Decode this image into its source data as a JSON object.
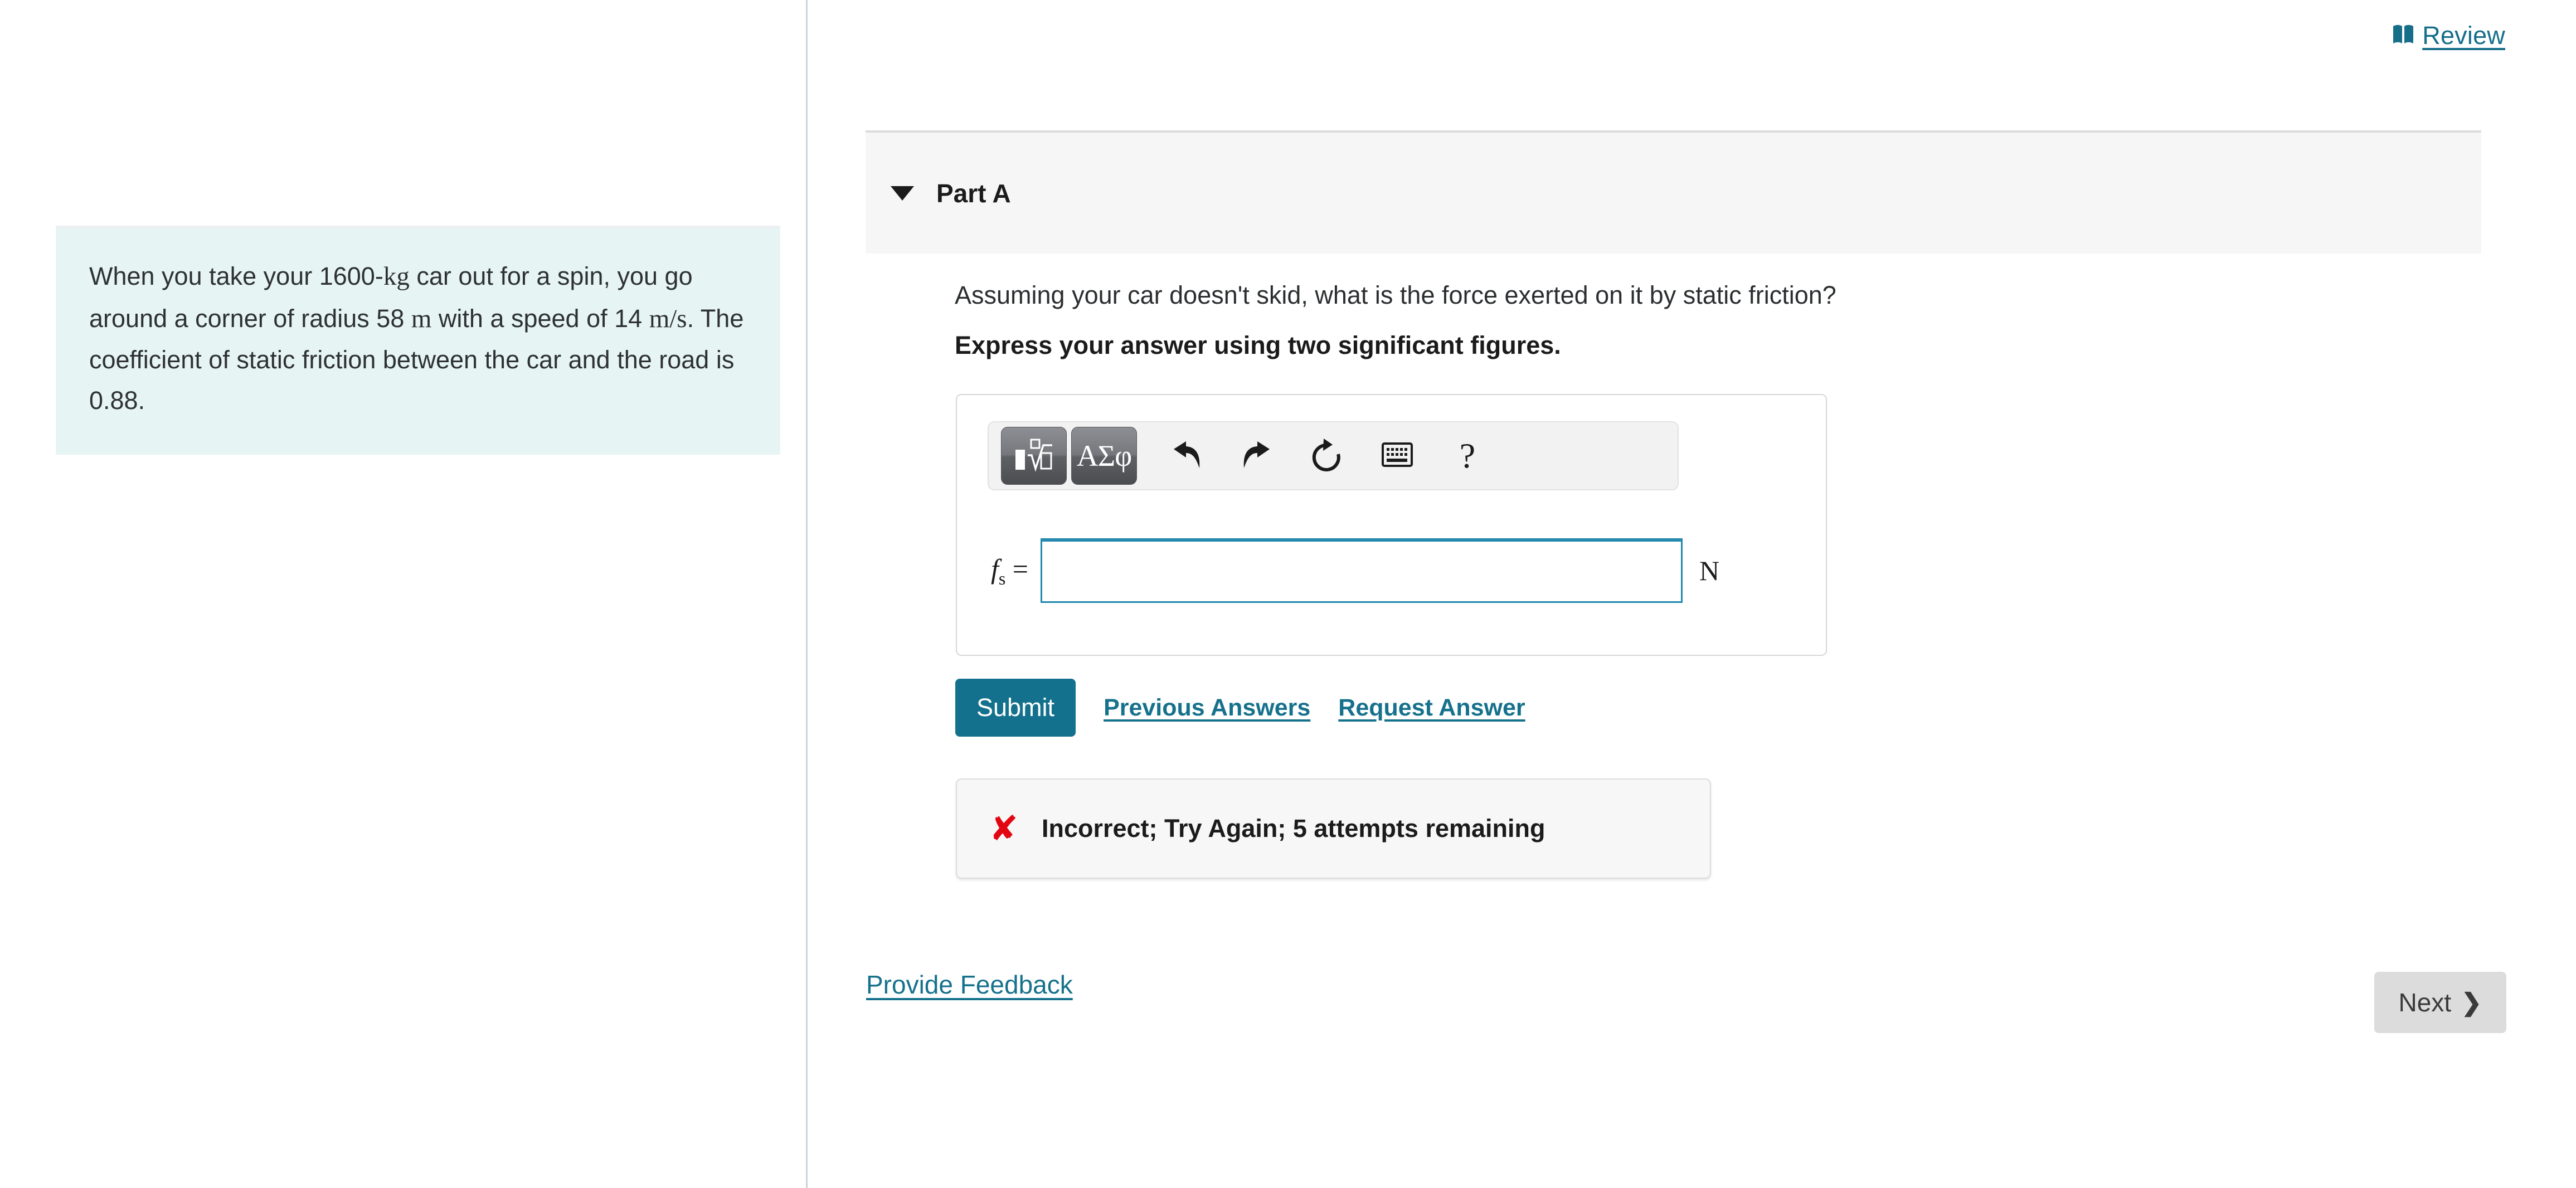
{
  "review": {
    "label": "Review",
    "icon": "book-icon"
  },
  "problem": {
    "line1_a": "When you take your 1600-",
    "unit_kg": "kg",
    "line1_b": " car out for a spin, you go around a corner of radius 58 ",
    "unit_m": "m",
    "line2_b": " with a speed of 14 ",
    "unit_ms": "m/s",
    "line3": ". The coefficient of static friction between the car and the road is 0.88."
  },
  "part": {
    "title": "Part A",
    "caret": "chevron-down-icon",
    "prompt": "Assuming your car doesn't skid, what is the force exerted on it by static friction?",
    "instruction": "Express your answer using two significant figures."
  },
  "toolbar": {
    "math_template_button": "math-template-icon",
    "greek_button": "ΑΣφ",
    "undo_button": "undo-icon",
    "redo_button": "redo-icon",
    "reset_button": "reset-icon",
    "keyboard_button": "keyboard-icon",
    "help_button": "?"
  },
  "answer": {
    "variable": "f",
    "subscript": "s",
    "equals": " =",
    "value": "",
    "placeholder": "",
    "unit": "N"
  },
  "actions": {
    "submit_label": "Submit",
    "previous_answers_label": "Previous Answers",
    "request_answer_label": "Request Answer"
  },
  "status": {
    "icon": "x-mark-icon",
    "message": "Incorrect; Try Again; 5 attempts remaining"
  },
  "footer": {
    "feedback_label": "Provide Feedback",
    "next_label": "Next",
    "next_chevron": "chevron-right-icon"
  },
  "colors": {
    "accent_teal": "#14718d",
    "link_teal": "#16718c",
    "problem_bg": "#e6f5f3",
    "error_red": "#e20613",
    "input_border": "#2389ae",
    "next_bg": "#dcdcdc"
  }
}
